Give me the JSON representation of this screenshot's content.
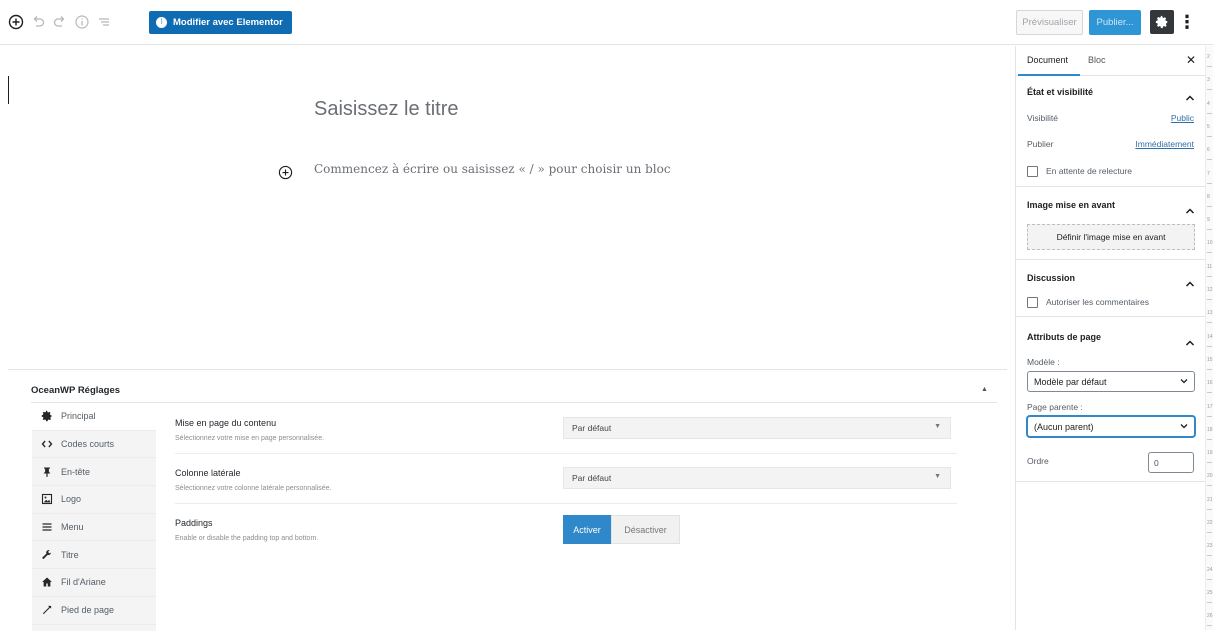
{
  "toolbar": {
    "elementor_label": "Modifier avec Elementor",
    "preview_label": "Prévisualiser",
    "publish_label": "Publier..."
  },
  "editor": {
    "title_placeholder": "Saisissez le titre",
    "block_placeholder": "Commencez à écrire ou saisissez « / » pour choisir un bloc"
  },
  "oceanwp": {
    "title": "OceanWP Réglages",
    "tabs": [
      {
        "label": "Principal",
        "icon": "gear-icon"
      },
      {
        "label": "Codes courts",
        "icon": "code-icon"
      },
      {
        "label": "En-tête",
        "icon": "pin-icon"
      },
      {
        "label": "Logo",
        "icon": "image-icon"
      },
      {
        "label": "Menu",
        "icon": "menu-icon"
      },
      {
        "label": "Titre",
        "icon": "wrench-icon"
      },
      {
        "label": "Fil d'Ariane",
        "icon": "home-icon"
      },
      {
        "label": "Pied de page",
        "icon": "hammer-icon"
      }
    ],
    "settings": {
      "layout": {
        "label": "Mise en page du contenu",
        "description": "Sélectionnez votre mise en page personnalisée.",
        "value": "Par défaut"
      },
      "sidebar": {
        "label": "Colonne latérale",
        "description": "Sélectionnez votre colonne latérale personnalisée.",
        "value": "Par défaut"
      },
      "paddings": {
        "label": "Paddings",
        "description": "Enable or disable the padding top and bottom.",
        "on_label": "Activer",
        "off_label": "Désactiver"
      }
    }
  },
  "sidebar": {
    "tab_document": "Document",
    "tab_bloc": "Bloc",
    "status": {
      "heading": "État et visibilité",
      "visibility_label": "Visibilité",
      "visibility_value": "Public",
      "publish_label": "Publier",
      "publish_value": "Immédiatement",
      "pending_label": "En attente de relecture"
    },
    "featured": {
      "heading": "Image mise en avant",
      "button_label": "Définir l'image mise en avant"
    },
    "discussion": {
      "heading": "Discussion",
      "comments_label": "Autoriser les commentaires"
    },
    "page_attributes": {
      "heading": "Attributs de page",
      "template_label": "Modèle :",
      "template_value": "Modèle par défaut",
      "parent_label": "Page parente :",
      "parent_value": "(Aucun parent)",
      "order_label": "Ordre",
      "order_value": "0"
    }
  },
  "ruler": {
    "labels": [
      "2",
      "3",
      "4",
      "5",
      "6",
      "7",
      "8",
      "9",
      "10",
      "11",
      "12",
      "13",
      "14",
      "15",
      "16",
      "17",
      "18",
      "19",
      "20",
      "21",
      "22",
      "23",
      "24",
      "25",
      "26"
    ]
  },
  "colors": {
    "accent": "#2f88c9",
    "elementor": "#0f6bb2",
    "settings_dark": "#32373c"
  }
}
